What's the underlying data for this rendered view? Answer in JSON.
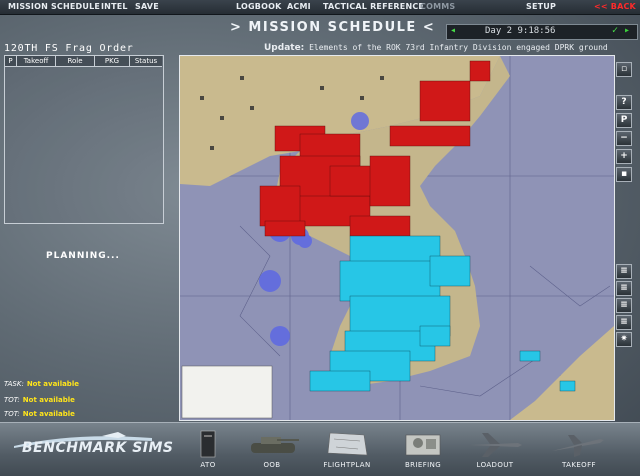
{
  "menu": {
    "items": [
      "MISSION SCHEDULE",
      "INTEL",
      "SAVE",
      "LOGBOOK",
      "ACMI",
      "TACTICAL REFERENCE",
      "COMMS",
      "SETUP"
    ],
    "back_label": "<< BACK"
  },
  "header": {
    "title": ">   MISSION SCHEDULE   <",
    "clock": "Day  2  9:18:56",
    "update_label": "Update:",
    "update_text": "Elements of the ROK 73rd Infantry Division engaged DPRK ground"
  },
  "frag": {
    "title": "120TH FS Frag Order",
    "columns": [
      "P",
      "Takeoff",
      "Role",
      "PKG",
      "Status"
    ],
    "planning_text": "PLANNING..."
  },
  "status": [
    {
      "key": "TASK:",
      "value": "Not available"
    },
    {
      "key": "TOT:",
      "value": "Not available"
    },
    {
      "key": "TOT:",
      "value": "Not available"
    }
  ],
  "toolbar": {
    "buttons": [
      {
        "name": "tool-window-button",
        "label": "▫"
      },
      {
        "name": "help-button",
        "label": "?"
      },
      {
        "name": "pin-button",
        "label": "P"
      },
      {
        "name": "zoom-out-button",
        "label": "−"
      },
      {
        "name": "zoom-in-button",
        "label": "+"
      },
      {
        "name": "layer-toggle-button",
        "label": "▪"
      },
      {
        "name": "filter-a-button",
        "label": "≡"
      },
      {
        "name": "filter-b-button",
        "label": "≡"
      },
      {
        "name": "filter-c-button",
        "label": "≡"
      },
      {
        "name": "filter-d-button",
        "label": "≡"
      },
      {
        "name": "ground-units-button",
        "label": "✷"
      }
    ]
  },
  "branding": {
    "logo_text": "BENCHMARK SIMS"
  },
  "nav": [
    {
      "name": "nav-ato",
      "label": "ATO",
      "icon": "folder-icon"
    },
    {
      "name": "nav-oob",
      "label": "OOB",
      "icon": "tank-icon"
    },
    {
      "name": "nav-flightplan",
      "label": "FLIGHTPLAN",
      "icon": "map-icon"
    },
    {
      "name": "nav-briefing",
      "label": "BRIEFING",
      "icon": "briefing-icon"
    },
    {
      "name": "nav-loadout",
      "label": "LOADOUT",
      "icon": "jet-icon"
    },
    {
      "name": "nav-takeoff",
      "label": "TAKEOFF",
      "icon": "takeoff-jet-icon"
    }
  ],
  "colors": {
    "enemy": "#d01818",
    "friendly": "#27c6e6",
    "land": "#c7b88f",
    "sea": "#8f93b6",
    "back": "#ff2a2a",
    "status_value": "#ffe51a"
  }
}
